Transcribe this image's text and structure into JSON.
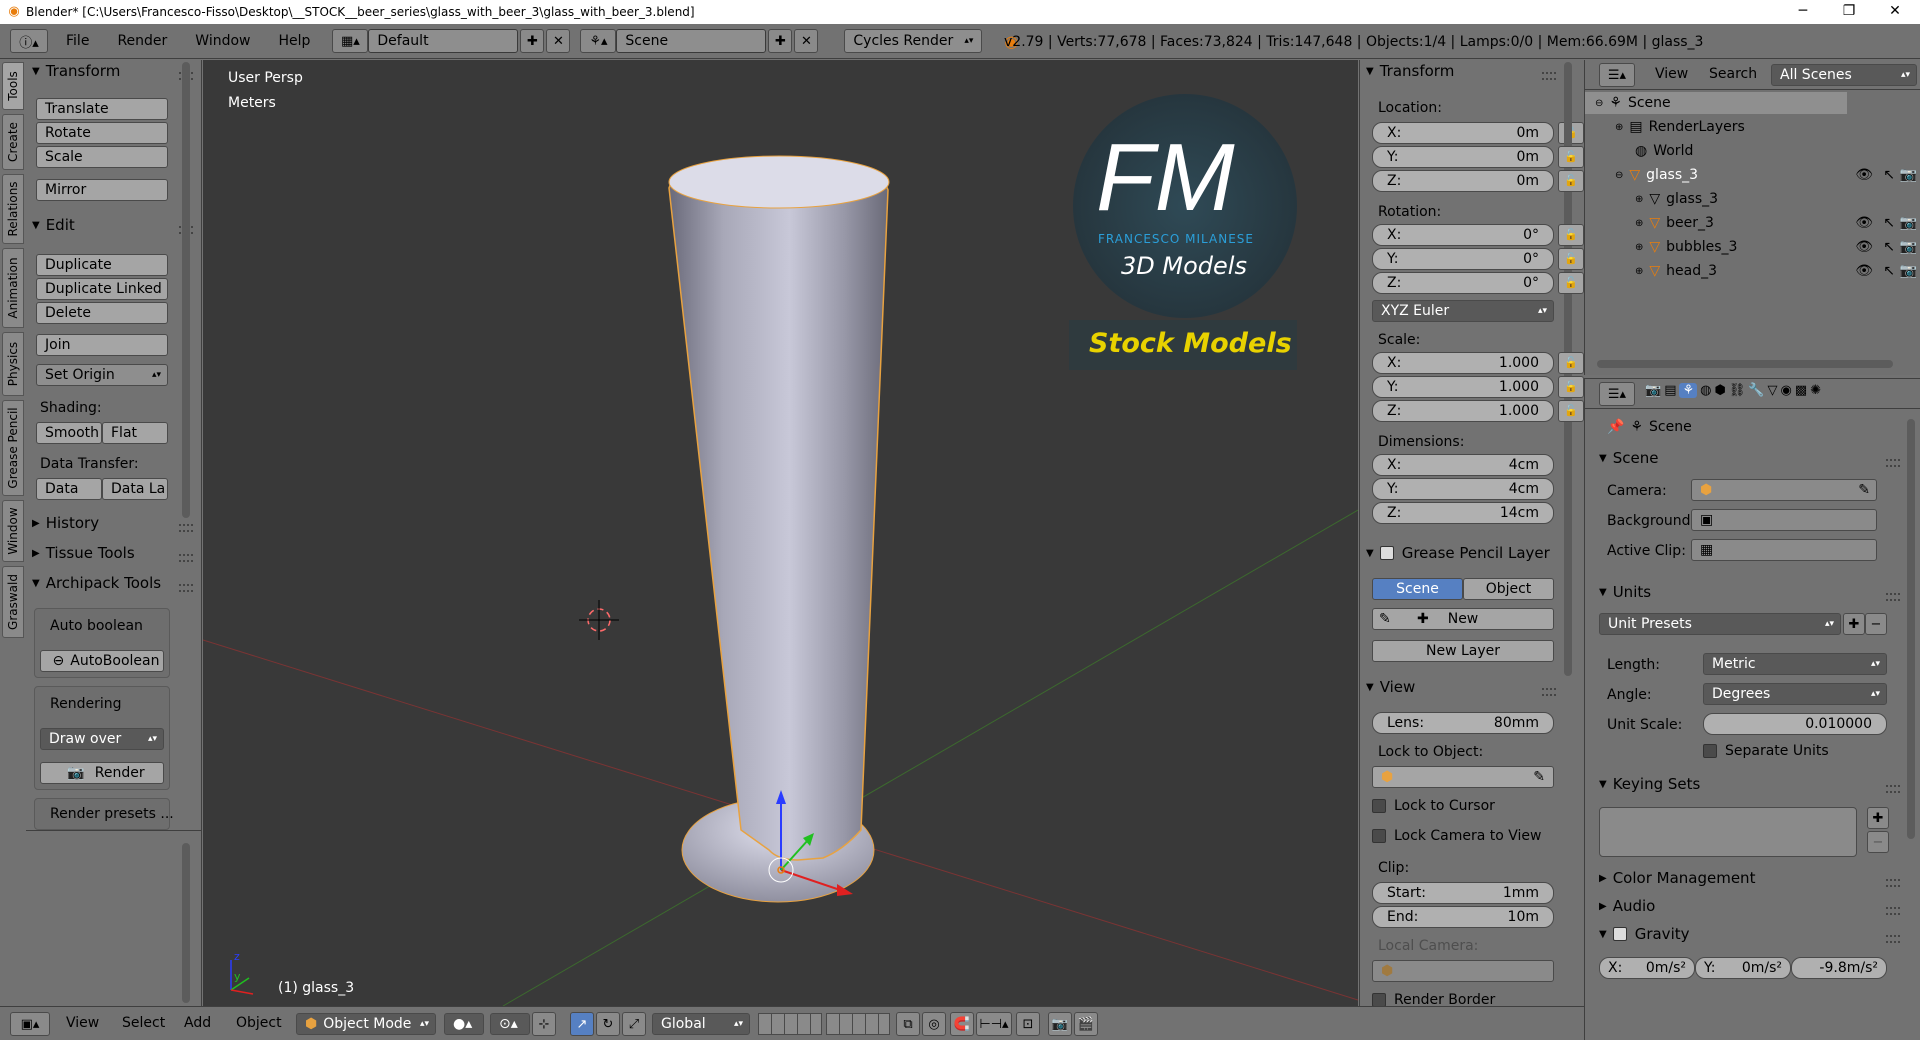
{
  "titlebar": {
    "title": "Blender* [C:\\Users\\Francesco-Fisso\\Desktop\\__STOCK__beer_series\\glass_with_beer_3\\glass_with_beer_3.blend]",
    "minimize": "─",
    "maximize": "❐",
    "close": "✕"
  },
  "menu": {
    "items": [
      "File",
      "Render",
      "Window",
      "Help"
    ],
    "layout": "Default",
    "scene": "Scene",
    "engine": "Cycles Render"
  },
  "stats": "v2.79 | Verts:77,678 | Faces:73,824 | Tris:147,648 | Objects:1/4 | Lamps:0/0 | Mem:66.69M | glass_3",
  "lefttabs": [
    "Tools",
    "Create",
    "Relations",
    "Animation",
    "Physics",
    "Grease Pencil",
    "Window",
    "Graswald"
  ],
  "tools": {
    "transform_header": "Transform",
    "translate": "Translate",
    "rotate": "Rotate",
    "scale": "Scale",
    "mirror": "Mirror",
    "edit_header": "Edit",
    "duplicate": "Duplicate",
    "duplicate_linked": "Duplicate Linked",
    "delete": "Delete",
    "join": "Join",
    "set_origin": "Set Origin",
    "shading_label": "Shading:",
    "smooth": "Smooth",
    "flat": "Flat",
    "data_transfer_label": "Data Transfer:",
    "data": "Data",
    "data_la": "Data La",
    "history": "History",
    "tissue_tools": "Tissue Tools",
    "archipack_tools": "Archipack Tools",
    "auto_boolean_label": "Auto boolean",
    "autoboolean_btn": "AutoBoolean",
    "rendering_label": "Rendering",
    "draw_over": "Draw over",
    "render_btn": "Render",
    "render_presets": "Render presets ..."
  },
  "viewport": {
    "view_label": "User Persp",
    "units_label": "Meters",
    "object_label": "(1) glass_3",
    "logo_fm": "FM",
    "logo_name": "FRANCESCO MILANESE",
    "logo_sub": "3D Models",
    "stock": "Stock Models",
    "axis_y": "y",
    "axis_z": "z"
  },
  "npanel": {
    "transform_header": "Transform",
    "location_label": "Location:",
    "location": [
      {
        "axis": "X:",
        "value": "0m"
      },
      {
        "axis": "Y:",
        "value": "0m"
      },
      {
        "axis": "Z:",
        "value": "0m"
      }
    ],
    "rotation_label": "Rotation:",
    "rotation": [
      {
        "axis": "X:",
        "value": "0°"
      },
      {
        "axis": "Y:",
        "value": "0°"
      },
      {
        "axis": "Z:",
        "value": "0°"
      }
    ],
    "rotation_mode": "XYZ Euler",
    "scale_label": "Scale:",
    "scale": [
      {
        "axis": "X:",
        "value": "1.000"
      },
      {
        "axis": "Y:",
        "value": "1.000"
      },
      {
        "axis": "Z:",
        "value": "1.000"
      }
    ],
    "dimensions_label": "Dimensions:",
    "dimensions": [
      {
        "axis": "X:",
        "value": "4cm"
      },
      {
        "axis": "Y:",
        "value": "4cm"
      },
      {
        "axis": "Z:",
        "value": "14cm"
      }
    ],
    "gp_header": "Grease Pencil Layer",
    "gp_scene": "Scene",
    "gp_object": "Object",
    "gp_new": "New",
    "gp_new_layer": "New Layer",
    "view_header": "View",
    "lens_label": "Lens:",
    "lens_value": "80mm",
    "lock_to_object": "Lock to Object:",
    "lock_to_cursor": "Lock to Cursor",
    "lock_camera": "Lock Camera to View",
    "clip_label": "Clip:",
    "clip_start_label": "Start:",
    "clip_start": "1mm",
    "clip_end_label": "End:",
    "clip_end": "10m",
    "local_camera": "Local Camera:",
    "render_border": "Render Border"
  },
  "outliner": {
    "view": "View",
    "search": "Search",
    "all_scenes": "All Scenes",
    "rows": [
      "Scene",
      "RenderLayers",
      "World",
      "glass_3",
      "glass_3",
      "beer_3",
      "bubbles_3",
      "head_3"
    ]
  },
  "properties": {
    "scene_crumb": "Scene",
    "scene_header": "Scene",
    "camera_label": "Camera:",
    "background_label": "Background:",
    "active_clip_label": "Active Clip:",
    "units_header": "Units",
    "unit_presets": "Unit Presets",
    "length_label": "Length:",
    "length_value": "Metric",
    "angle_label": "Angle:",
    "angle_value": "Degrees",
    "unit_scale_label": "Unit Scale:",
    "unit_scale_value": "0.010000",
    "separate_units": "Separate Units",
    "keying_sets": "Keying Sets",
    "color_management": "Color Management",
    "audio": "Audio",
    "gravity": "Gravity",
    "gx_label": "X:",
    "gx": "0m/s²",
    "gy_label": "Y:",
    "gy": "0m/s²",
    "gz": "-9.8m/s²"
  },
  "bottom": {
    "view": "View",
    "select": "Select",
    "add": "Add",
    "object": "Object",
    "mode": "Object Mode",
    "orientation": "Global"
  },
  "colors": {
    "viewport_bg": "#393939",
    "panel_bg": "#727272",
    "accent_blue": "#5680c2",
    "logo_blue": "#2b9fd9",
    "stock_yellow": "#e8d200"
  }
}
